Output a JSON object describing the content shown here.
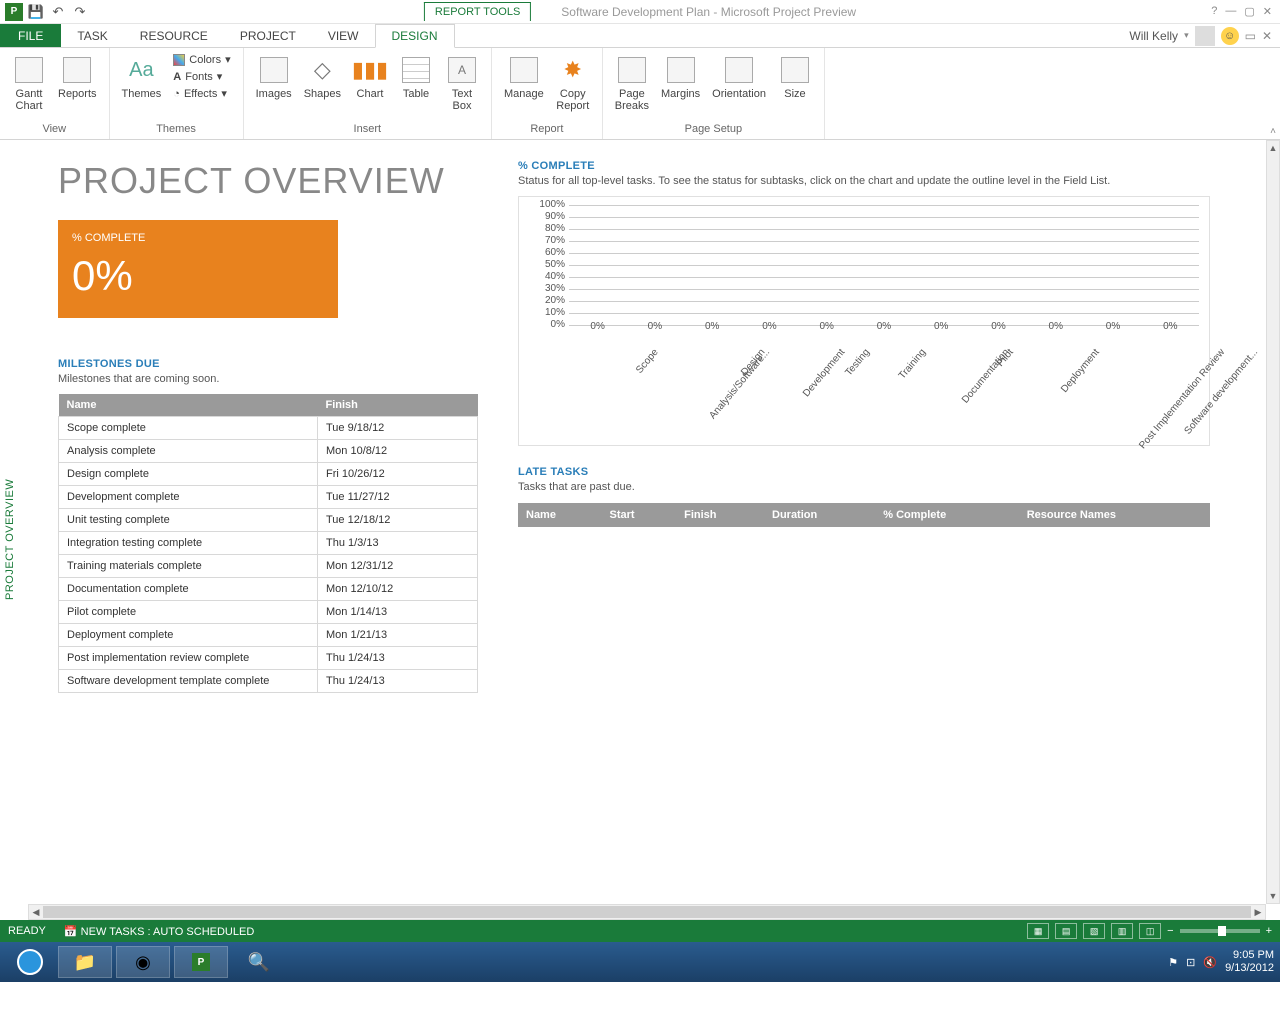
{
  "titlebar": {
    "report_tools": "REPORT TOOLS",
    "title": "Software Development Plan - Microsoft Project Preview"
  },
  "tabs": {
    "file": "FILE",
    "task": "TASK",
    "resource": "RESOURCE",
    "project": "PROJECT",
    "view": "VIEW",
    "design": "DESIGN"
  },
  "user": {
    "name": "Will Kelly"
  },
  "ribbon": {
    "view": {
      "gantt": "Gantt\nChart",
      "reports": "Reports",
      "label": "View"
    },
    "themes": {
      "themes": "Themes",
      "colors": "Colors",
      "fonts": "Fonts",
      "effects": "Effects",
      "label": "Themes"
    },
    "insert": {
      "images": "Images",
      "shapes": "Shapes",
      "chart": "Chart",
      "table": "Table",
      "textbox": "Text\nBox",
      "label": "Insert"
    },
    "report": {
      "manage": "Manage",
      "copy": "Copy\nReport",
      "label": "Report"
    },
    "page": {
      "breaks": "Page\nBreaks",
      "margins": "Margins",
      "orientation": "Orientation",
      "size": "Size",
      "label": "Page Setup"
    }
  },
  "side_tab": "PROJECT OVERVIEW",
  "report": {
    "title": "PROJECT OVERVIEW",
    "kpi_label": "% COMPLETE",
    "kpi_value": "0%",
    "milestones_title": "MILESTONES DUE",
    "milestones_desc": "Milestones that are coming soon.",
    "milestones_headers": {
      "name": "Name",
      "finish": "Finish"
    },
    "milestones": [
      {
        "name": "Scope complete",
        "finish": "Tue 9/18/12"
      },
      {
        "name": "Analysis complete",
        "finish": "Mon 10/8/12"
      },
      {
        "name": "Design complete",
        "finish": "Fri 10/26/12"
      },
      {
        "name": "Development complete",
        "finish": "Tue 11/27/12"
      },
      {
        "name": "Unit testing complete",
        "finish": "Tue 12/18/12"
      },
      {
        "name": "Integration testing complete",
        "finish": "Thu 1/3/13"
      },
      {
        "name": "Training materials complete",
        "finish": "Mon 12/31/12"
      },
      {
        "name": "Documentation complete",
        "finish": "Mon 12/10/12"
      },
      {
        "name": "Pilot complete",
        "finish": "Mon 1/14/13"
      },
      {
        "name": "Deployment complete",
        "finish": "Mon 1/21/13"
      },
      {
        "name": "Post implementation review complete",
        "finish": "Thu 1/24/13"
      },
      {
        "name": "Software development template complete",
        "finish": "Thu 1/24/13"
      }
    ],
    "pct_title": "% COMPLETE",
    "pct_desc": "Status for all top-level tasks. To see the status for subtasks, click on the chart and update the outline level in the Field List.",
    "late_title": "LATE TASKS",
    "late_desc": "Tasks that are past due.",
    "late_headers": {
      "name": "Name",
      "start": "Start",
      "finish": "Finish",
      "duration": "Duration",
      "pct": "% Complete",
      "res": "Resource Names"
    }
  },
  "chart_data": {
    "type": "bar",
    "categories": [
      "Scope",
      "Analysis/Software...",
      "Design",
      "Development",
      "Testing",
      "Training",
      "Documentation",
      "Pilot",
      "Deployment",
      "Post Implementation Review",
      "Software development..."
    ],
    "values": [
      0,
      0,
      0,
      0,
      0,
      0,
      0,
      0,
      0,
      0,
      0
    ],
    "value_labels": [
      "0%",
      "0%",
      "0%",
      "0%",
      "0%",
      "0%",
      "0%",
      "0%",
      "0%",
      "0%",
      "0%"
    ],
    "yticks": [
      "100%",
      "90%",
      "80%",
      "70%",
      "60%",
      "50%",
      "40%",
      "30%",
      "20%",
      "10%",
      "0%"
    ],
    "ylim": [
      0,
      100
    ]
  },
  "statusbar": {
    "ready": "READY",
    "newtasks": "NEW TASKS : AUTO SCHEDULED"
  },
  "tray": {
    "time": "9:05 PM",
    "date": "9/13/2012"
  }
}
